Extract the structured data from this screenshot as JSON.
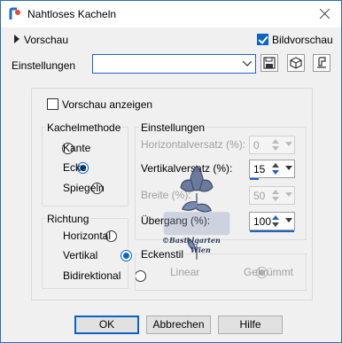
{
  "window": {
    "title": "Nahtloses Kacheln"
  },
  "top": {
    "preview_label": "Vorschau",
    "dialog_preview_label": "Bildvorschau",
    "dialog_preview_checked": true
  },
  "presets": {
    "label": "Einstellungen",
    "value": ""
  },
  "show_preview": {
    "label": "Vorschau anzeigen",
    "checked": false
  },
  "kachelmethode": {
    "title": "Kachelmethode",
    "options": [
      "Kante",
      "Ecke",
      "Spiegeln"
    ],
    "selected": "Ecke"
  },
  "richtung": {
    "title": "Richtung",
    "options": [
      "Horizontal",
      "Vertikal",
      "Bidirektional"
    ],
    "selected": "Vertikal"
  },
  "settings": {
    "title": "Einstellungen",
    "horizontal_offset": {
      "label": "Horizontalversatz (%):",
      "value": "0",
      "enabled": false
    },
    "vertical_offset": {
      "label": "Vertikalversatz (%):",
      "value": "15",
      "enabled": true
    },
    "width": {
      "label": "Breite (%):",
      "value": "50",
      "enabled": false
    },
    "transition": {
      "label": "Übergang (%):",
      "value": "100",
      "enabled": true
    }
  },
  "eckenstil": {
    "title": "Eckenstil",
    "options": [
      "Linear",
      "Gekrümmt"
    ],
    "selected": "Linear",
    "enabled": false
  },
  "watermark": {
    "line1": "©Bastelgarten",
    "line2": "Wien"
  },
  "buttons": {
    "ok": "OK",
    "cancel": "Abbrechen",
    "help": "Hilfe"
  },
  "colors": {
    "accent": "#0a64c8",
    "window_border": "#2b6fb6"
  }
}
